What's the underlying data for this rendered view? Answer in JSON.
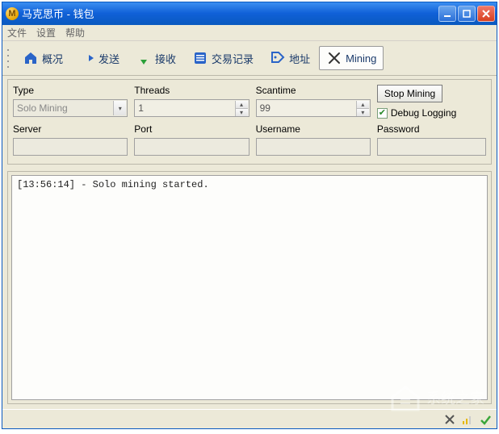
{
  "window": {
    "title": "马克思币 - 钱包"
  },
  "menu": {
    "file": "文件",
    "settings": "设置",
    "help": "帮助"
  },
  "toolbar": {
    "overview": "概况",
    "send": "发送",
    "receive": "接收",
    "transactions": "交易记录",
    "address": "地址",
    "mining": "Mining"
  },
  "form": {
    "labels": {
      "type": "Type",
      "threads": "Threads",
      "scantime": "Scantime",
      "server": "Server",
      "port": "Port",
      "username": "Username",
      "password": "Password"
    },
    "values": {
      "type": "Solo Mining",
      "threads": "1",
      "scantime": "99",
      "server": "",
      "port": "",
      "username": "",
      "password": ""
    },
    "stop_button": "Stop Mining",
    "debug_logging_label": "Debug Logging",
    "debug_logging_checked": true
  },
  "log": {
    "line1": "[13:56:14] - Solo mining started."
  },
  "watermark": "系统之家"
}
